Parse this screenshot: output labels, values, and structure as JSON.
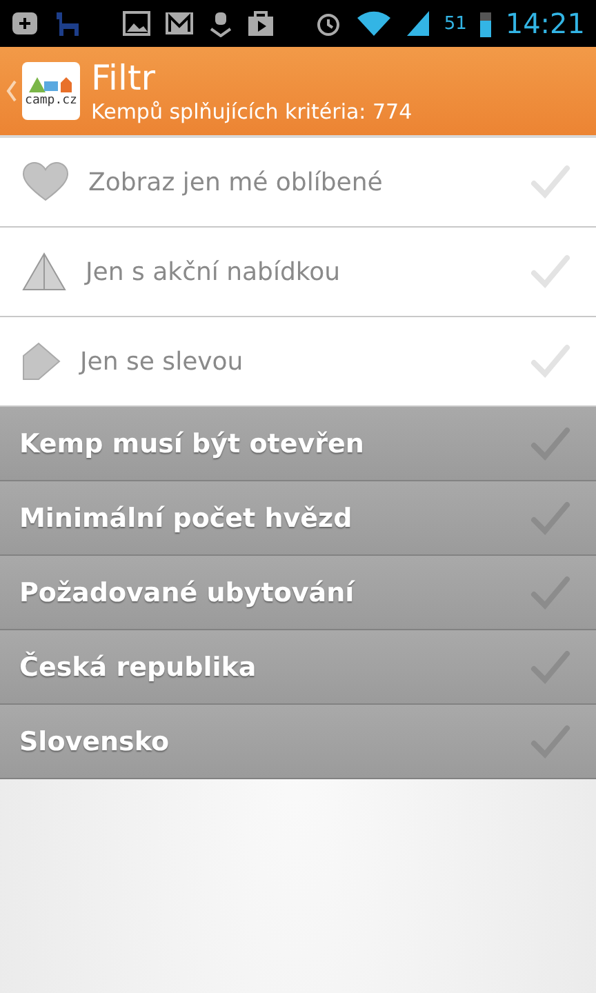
{
  "status_bar": {
    "battery_percent": "51",
    "time": "14:21"
  },
  "header": {
    "logo_text": "camp.cz",
    "title": "Filtr",
    "subtitle": "Kempů splňujících kritéria: 774"
  },
  "items": [
    {
      "kind": "option",
      "label": "Zobraz jen mé oblíbené",
      "checked": false
    },
    {
      "kind": "option",
      "label": "Jen s akční nabídkou",
      "checked": false
    },
    {
      "kind": "option",
      "label": "Jen se slevou",
      "checked": false
    },
    {
      "kind": "section",
      "label": "Kemp musí být otevřen",
      "checked": false
    },
    {
      "kind": "section",
      "label": "Minimální počet hvězd",
      "checked": false
    },
    {
      "kind": "section",
      "label": "Požadované ubytování",
      "checked": false
    },
    {
      "kind": "section",
      "label": "Česká republika",
      "checked": false
    },
    {
      "kind": "section",
      "label": "Slovensko",
      "checked": false
    }
  ]
}
